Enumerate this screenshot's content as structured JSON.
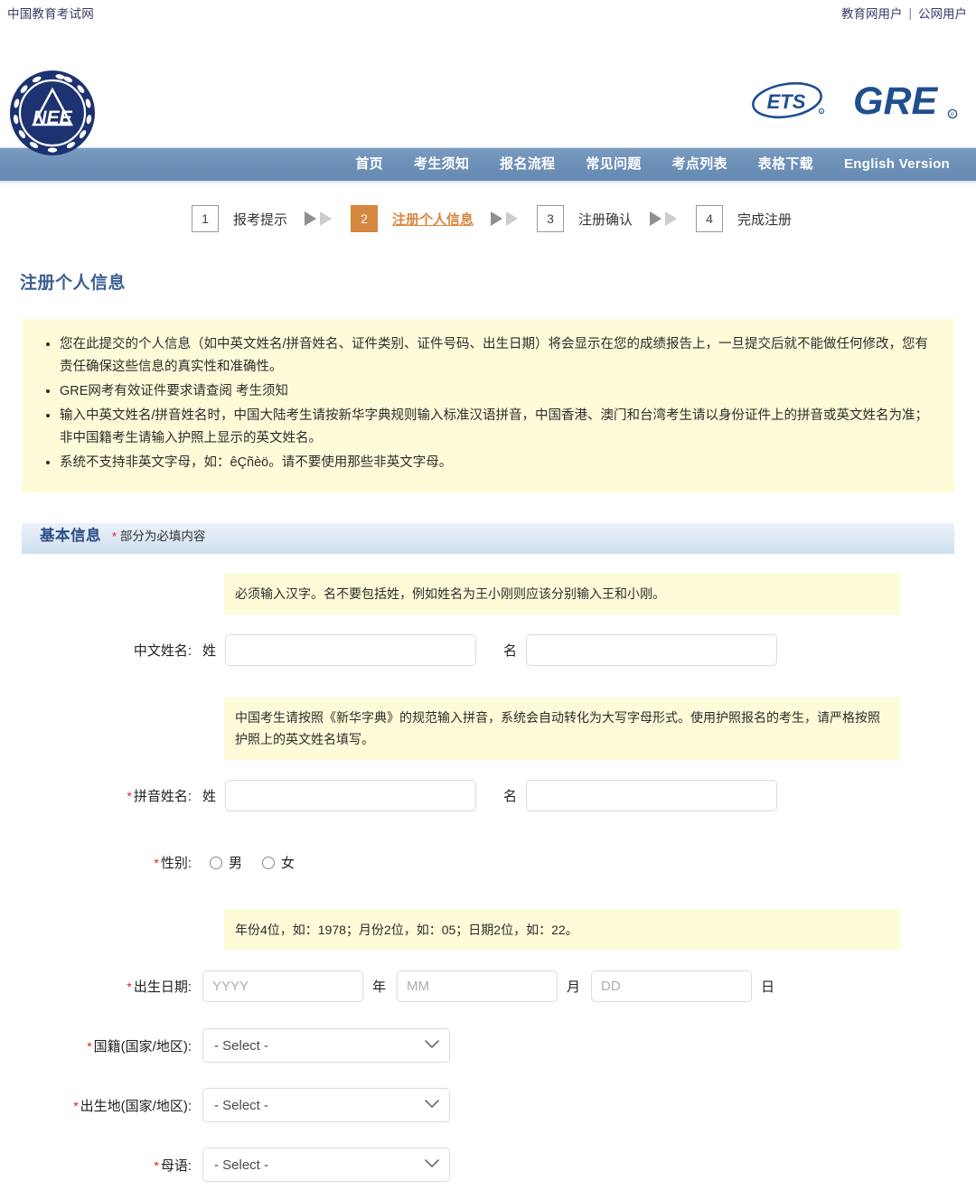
{
  "topbar": {
    "site_name": "中国教育考试网",
    "link_edu": "教育网用户",
    "separator": "|",
    "link_public": "公网用户"
  },
  "header": {
    "neea_logo_alt": "NEEA",
    "neea_logo_text": "NEE",
    "ets_logo_text": "ETS",
    "gre_logo_text": "GRE",
    "registered_mark": "®"
  },
  "nav": {
    "items": [
      {
        "label": "首页",
        "name": "nav-home"
      },
      {
        "label": "考生须知",
        "name": "nav-notice"
      },
      {
        "label": "报名流程",
        "name": "nav-process"
      },
      {
        "label": "常见问题",
        "name": "nav-faq"
      },
      {
        "label": "考点列表",
        "name": "nav-centers"
      },
      {
        "label": "表格下载",
        "name": "nav-downloads"
      },
      {
        "label": "English Version",
        "name": "nav-english"
      }
    ]
  },
  "steps": [
    {
      "num": "1",
      "label": "报考提示",
      "active": false
    },
    {
      "num": "2",
      "label": "注册个人信息",
      "active": true
    },
    {
      "num": "3",
      "label": "注册确认",
      "active": false
    },
    {
      "num": "4",
      "label": "完成注册",
      "active": false
    }
  ],
  "page": {
    "title": "注册个人信息"
  },
  "notice": {
    "bullets": [
      "您在此提交的个人信息（如中英文姓名/拼音姓名、证件类别、证件号码、出生日期）将会显示在您的成绩报告上，一旦提交后就不能做任何修改，您有责任确保这些信息的真实性和准确性。",
      "GRE网考有效证件要求请查阅 考生须知",
      "输入中英文姓名/拼音姓名时，中国大陆考生请按新华字典规则输入标准汉语拼音，中国香港、澳门和台湾考生请以身份证件上的拼音或英文姓名为准；非中国籍考生请输入护照上显示的英文姓名。",
      "系统不支持非英文字母，如：êÇñèö。请不要使用那些非英文字母。"
    ],
    "link_label": "考生须知"
  },
  "section": {
    "title": "基本信息",
    "star": "*",
    "subtitle": "部分为必填内容"
  },
  "form": {
    "chinese_name": {
      "hint": "必须输入汉字。名不要包括姓，例如姓名为王小刚则应该分别输入王和小刚。",
      "label": "中文姓名:",
      "surname_label": "姓",
      "surname_value": "",
      "surname_placeholder": "",
      "givenname_label": "名",
      "givenname_value": "",
      "givenname_placeholder": ""
    },
    "pinyin_name": {
      "hint": "中国考生请按照《新华字典》的规范输入拼音，系统会自动转化为大写字母形式。使用护照报名的考生，请严格按照护照上的英文姓名填写。",
      "star": "*",
      "label": "拼音姓名:",
      "surname_label": "姓",
      "surname_value": "",
      "surname_placeholder": "",
      "givenname_label": "名",
      "givenname_value": "",
      "givenname_placeholder": ""
    },
    "gender": {
      "star": "*",
      "label": "性别:",
      "options": [
        {
          "label": "男",
          "checked": false
        },
        {
          "label": "女",
          "checked": false
        }
      ]
    },
    "birthdate": {
      "hint": "年份4位，如：1978；月份2位，如：05；日期2位，如：22。",
      "star": "*",
      "label": "出生日期:",
      "year_value": "",
      "year_placeholder": "YYYY",
      "year_unit": "年",
      "month_value": "",
      "month_placeholder": "MM",
      "month_unit": "月",
      "day_value": "",
      "day_placeholder": "DD",
      "day_unit": "日"
    },
    "nationality": {
      "star": "*",
      "label": "国籍(国家/地区):",
      "selected": "- Select -"
    },
    "birthplace": {
      "star": "*",
      "label": "出生地(国家/地区):",
      "selected": "- Select -"
    },
    "native_language": {
      "star": "*",
      "label": "母语:",
      "selected": "- Select -"
    }
  },
  "colors": {
    "nav_blue": "#6d90b7",
    "accent_orange": "#d6873f",
    "title_blue": "#3c5f93",
    "notice_yellow": "#fdfbd8",
    "required_red": "#e02020",
    "brand_navy": "#1f3a7a"
  }
}
